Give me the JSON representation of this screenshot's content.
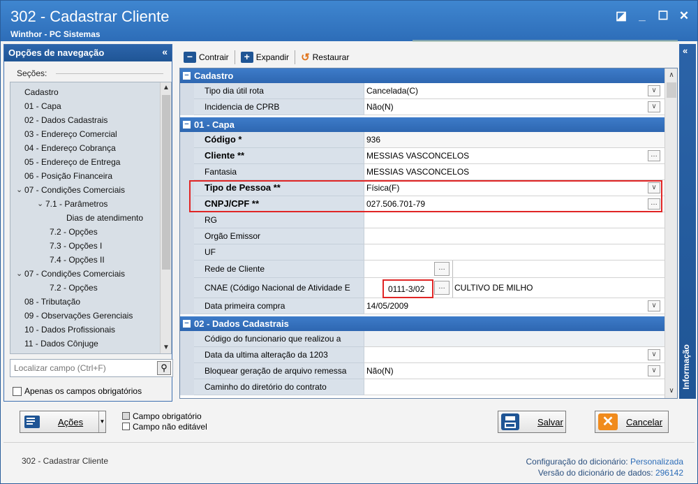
{
  "window": {
    "title": "302 - Cadastrar Cliente",
    "subtitle": "Winthor - PC Sistemas",
    "controls": [
      "◪",
      "_",
      "☐",
      "✕"
    ]
  },
  "nav": {
    "header": "Opções de navegação",
    "collapse": "«",
    "sections_label": "Seções:",
    "items": [
      {
        "label": "Cadastro"
      },
      {
        "label": "01 - Capa"
      },
      {
        "label": "02 - Dados Cadastrais"
      },
      {
        "label": "03 - Endereço Comercial"
      },
      {
        "label": "04 - Endereço Cobrança"
      },
      {
        "label": "05 - Endereço de Entrega"
      },
      {
        "label": "06 - Posição Financeira"
      },
      {
        "label": "07 - Condições Comerciais"
      },
      {
        "label": "7.1 - Parâmetros"
      },
      {
        "label": "Dias de atendimento"
      },
      {
        "label": "7.2 - Opções"
      },
      {
        "label": "7.3 - Opções I"
      },
      {
        "label": "7.4 - Opções II"
      },
      {
        "label": "07 - Condições Comerciais"
      },
      {
        "label": "7.2 - Opções"
      },
      {
        "label": "08 - Tributação"
      },
      {
        "label": "09 - Observações Gerenciais"
      },
      {
        "label": "10 - Dados Profissionais"
      },
      {
        "label": "11 - Dados Cônjuge"
      }
    ],
    "search_placeholder": "Localizar campo (Ctrl+F)",
    "required_only": "Apenas os campos obrigatórios"
  },
  "toolbar": {
    "collapse": "Contrair",
    "expand": "Expandir",
    "restore": "Restaurar"
  },
  "grid": {
    "section_cadastro": "Cadastro",
    "tipo_dia_label": "Tipo dia útil rota",
    "tipo_dia_value": "Cancelada(C)",
    "cprb_label": "Incidencia de CPRB",
    "cprb_value": "Não(N)",
    "section_capa": "01 - Capa",
    "codigo_label": "Código *",
    "codigo_value": "936",
    "cliente_label": "Cliente **",
    "cliente_value": "MESSIAS VASCONCELOS",
    "fantasia_label": "Fantasia",
    "fantasia_value": "MESSIAS VASCONCELOS",
    "tipo_pessoa_label": "Tipo de Pessoa **",
    "tipo_pessoa_value": "Física(F)",
    "cnpj_label": "CNPJ/CPF **",
    "cnpj_value": "027.506.701-79",
    "rg_label": "RG",
    "orgao_label": "Orgão Emissor",
    "uf_label": "UF",
    "rede_label": "Rede de Cliente",
    "cnae_label": "CNAE (Código Nacional de Atividade E",
    "cnae_code": "0111-3/02",
    "cnae_desc": "CULTIVO DE MILHO",
    "data_compra_label": "Data primeira compra",
    "data_compra_value": "14/05/2009",
    "section_dados": "02 - Dados Cadastrais",
    "cod_func_label": "Código do funcionario que realizou a",
    "data_alt_label": "Data da ultima alteração da 1203",
    "bloquear_label": "Bloquear geração de arquivo remessa",
    "bloquear_value": "Não(N)",
    "caminho_label": "Caminho do diretório do contrato"
  },
  "info_panel": {
    "label": "Informação",
    "collapse": "«"
  },
  "bottom": {
    "actions": "Ações",
    "legend_required": "Campo obrigatório",
    "legend_readonly": "Campo não editável",
    "save": "Salvar",
    "cancel": "Cancelar"
  },
  "footer": {
    "left": "302 - Cadastrar Cliente",
    "dict_config_label": "Configuração do dicionário:",
    "dict_config_value": "Personalizada",
    "dict_version_label": "Versão do dicionário de dados:",
    "dict_version_value": "296142"
  },
  "colors": {
    "title_bar": "#2d6db8",
    "section_header": "#2e67b1",
    "highlight": "#e02525",
    "save_icon": "#1f5595",
    "cancel_icon": "#f08b1d"
  }
}
